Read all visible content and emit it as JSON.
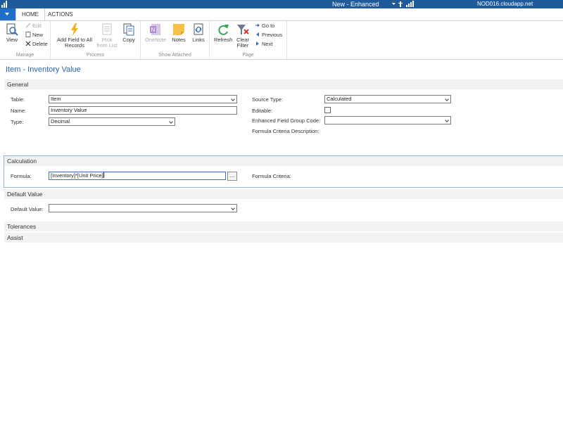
{
  "titlebar": {
    "title": "New - Enhanced",
    "server": "NOD016.cloudapp.net"
  },
  "tabs": {
    "home": "HOME",
    "actions": "ACTIONS"
  },
  "ribbon": {
    "manage": {
      "label": "Manage",
      "view": "View",
      "edit": "Edit",
      "new": "New",
      "delete": "Delete"
    },
    "process": {
      "label": "Process",
      "add_field_line1": "Add Field to All",
      "add_field_line2": "Records",
      "pick_line1": "Pick",
      "pick_line2": "from List",
      "copy": "Copy"
    },
    "show_attached": {
      "label": "Show Attached",
      "onenote": "OneNote",
      "notes": "Notes",
      "links": "Links"
    },
    "page": {
      "label": "Page",
      "refresh": "Refresh",
      "clear_line1": "Clear",
      "clear_line2": "Filter",
      "goto": "Go to",
      "previous": "Previous",
      "next": "Next"
    }
  },
  "page_title": "Item - Inventory Value",
  "general": {
    "header": "General",
    "table_label": "Table:",
    "table_value": "Item",
    "name_label": "Name:",
    "name_value": "Inventory Value",
    "type_label": "Type:",
    "type_value": "Decimal",
    "source_type_label": "Source Type:",
    "source_type_value": "Calculated",
    "editable_label": "Editable:",
    "editable_checked": false,
    "group_code_label": "Enhanced Field Group Code:",
    "group_code_value": "",
    "criteria_desc_label": "Formula Criteria Description:"
  },
  "calculation": {
    "header": "Calculation",
    "formula_label": "Formula:",
    "formula_value": "[Inventory]*[Unit Price]",
    "ellipsis": "...",
    "criteria_label": "Formula Criteria:"
  },
  "default_value": {
    "header": "Default Value",
    "label": "Default Value:",
    "value": ""
  },
  "tolerances": {
    "header": "Tolerances"
  },
  "assist": {
    "header": "Assist"
  }
}
